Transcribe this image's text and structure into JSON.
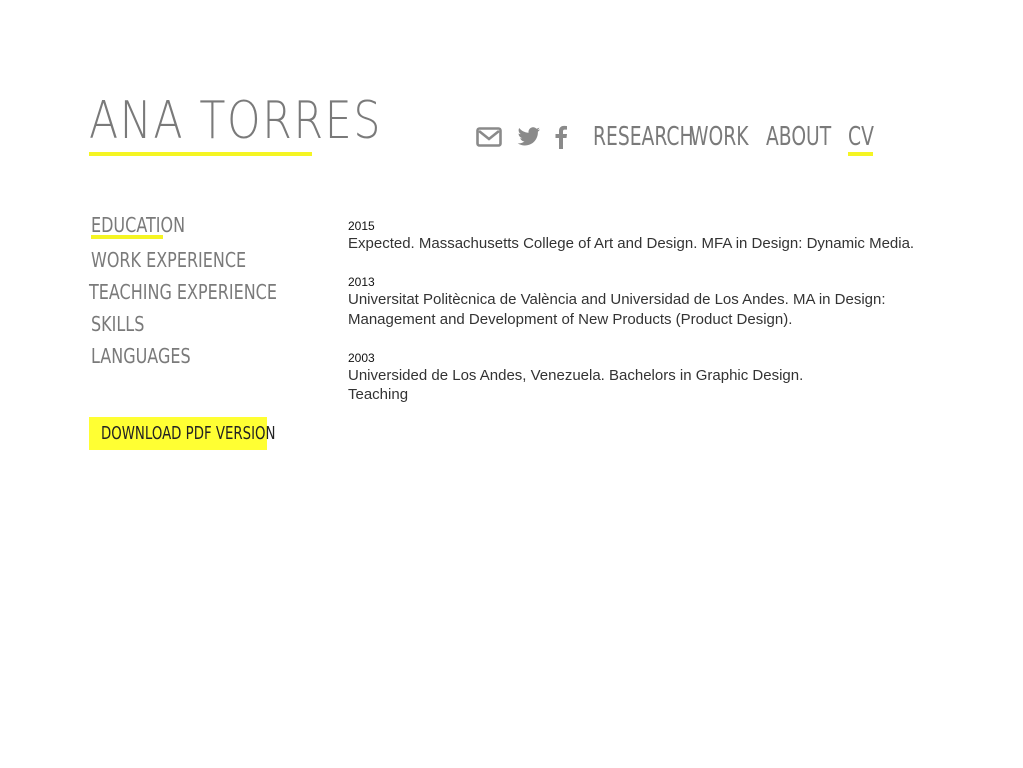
{
  "header": {
    "logo": "ANA TORRES",
    "accent_color": "#f5f523",
    "social_icons": [
      "envelope-icon",
      "twitter-icon",
      "facebook-icon"
    ],
    "nav": {
      "research": "RESEARCH",
      "work": "WORK",
      "about": "ABOUT",
      "cv": "CV"
    },
    "active_nav": "CV"
  },
  "sidebar": {
    "items": [
      "EDUCATION",
      "WORK EXPERIENCE",
      "TEACHING EXPERIENCE",
      "SKILLS",
      "LANGUAGES"
    ],
    "active": "EDUCATION",
    "download_label": "DOWNLOAD PDF VERSION",
    "download_color": "#ffff33"
  },
  "education": [
    {
      "year": "2015",
      "text": "Expected. Massachusetts College of Art and Design. MFA in Design: Dynamic Media."
    },
    {
      "year": "2013",
      "text": "Universitat Politècnica de València and Universidad de Los Andes. MA in Design: Management and Development of New Products (Product Design)."
    },
    {
      "year": "2003",
      "text": "Universided de Los Andes, Venezuela. Bachelors in Graphic Design."
    }
  ],
  "trailing_text": "Teaching"
}
